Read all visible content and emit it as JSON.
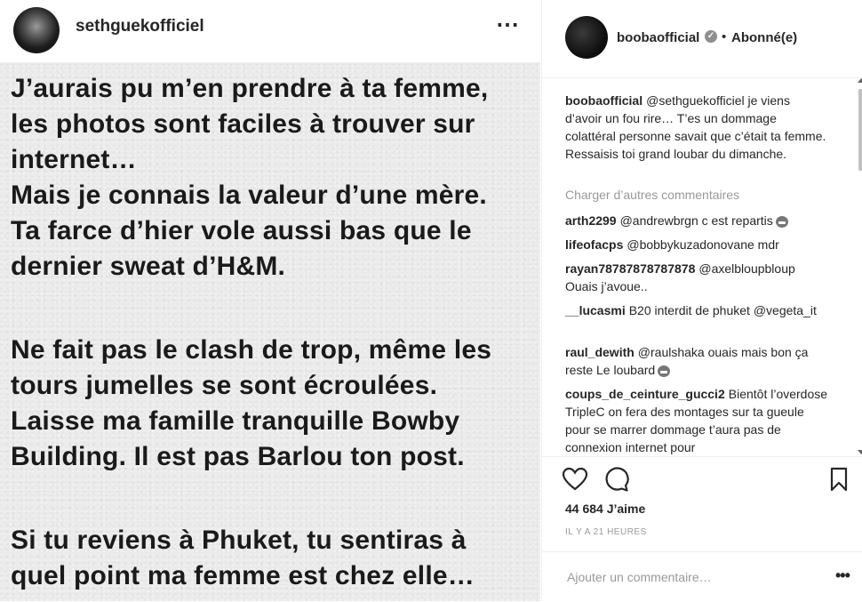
{
  "left_header": {
    "username": "sethguekofficiel",
    "more_icon": "⋯"
  },
  "post_text": [
    "J’aurais pu m’en prendre à ta femme,",
    "les photos sont faciles à trouver sur",
    "internet…",
    "Mais je connais la valeur d’une mère.",
    "Ta farce d’hier vole aussi bas que le",
    "dernier sweat d’H&M.",
    "Ne fait pas le clash de trop, même les",
    "tours jumelles se sont écroulées.",
    "Laisse ma famille tranquille Bowby",
    "Building. Il est pas Barlou ton post.",
    "Si tu reviens à Phuket, tu sentiras à",
    "quel point ma femme est chez elle…"
  ],
  "right_header": {
    "username": "boobaofficial",
    "separator": "•",
    "follow_status": "Abonné(e)",
    "verified_mark": "✓"
  },
  "caption": {
    "user": "boobaofficial",
    "text": "@sethguekofficiel je viens d’avoir un fou rire… T’es un dommage colattéral personne savait que c’était ta femme. Ressaisis toi grand loubar du dimanche."
  },
  "load_more": "Charger d’autres commentaires",
  "comments": [
    {
      "user": "arth2299",
      "text": "@andrewbrgn c est repartis"
    },
    {
      "user": "lifeofacps",
      "text": "@bobbykuzadonovane mdr"
    },
    {
      "user": "rayan78787878787878",
      "text": "@axelbloupbloup Ouais j’avoue.."
    },
    {
      "user": "__lucasmi",
      "text": "B20 interdit de phuket @vegeta_it"
    },
    {
      "user": "raul_dewith",
      "text": "@raulshaka ouais mais bon ça reste Le loubard"
    },
    {
      "user": "coups_de_ceinture_gucci2",
      "text": "Bientôt l’overdose TripleC on fera des montages sur ta gueule pour se marrer dommage t’aura pas de connexion internet pour"
    }
  ],
  "likes": "44 684 J’aime",
  "timestamp": "IL Y A 21 HEURES",
  "add_comment": {
    "placeholder": "Ajouter un commentaire…",
    "more_icon": "•••"
  }
}
